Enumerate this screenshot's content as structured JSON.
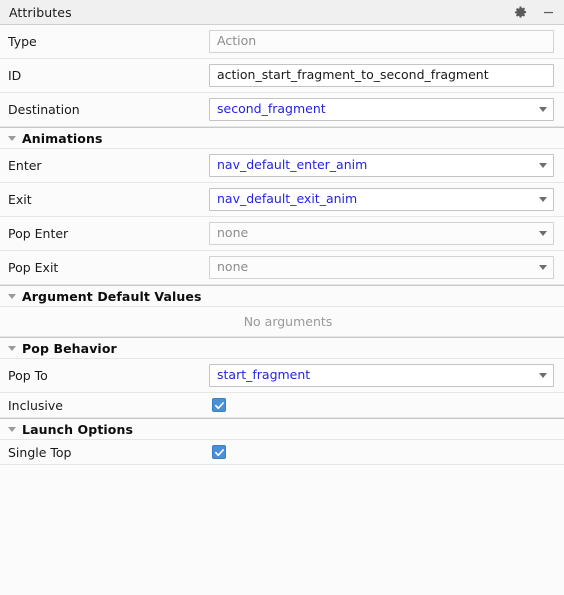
{
  "titlebar": {
    "title": "Attributes",
    "settings_icon": "gear-icon",
    "minimize_icon": "minimize-icon"
  },
  "fields": {
    "type": {
      "label": "Type",
      "value": "Action",
      "state": "muted",
      "control": "textfield"
    },
    "id": {
      "label": "ID",
      "value": "action_start_fragment_to_second_fragment",
      "state": "dark",
      "control": "textfield"
    },
    "destination": {
      "label": "Destination",
      "value": "second_fragment",
      "state": "blue",
      "control": "combobox"
    }
  },
  "sections": {
    "animations": {
      "title": "Animations",
      "rows": [
        {
          "label": "Enter",
          "value": "nav_default_enter_anim",
          "state": "blue",
          "control": "combobox"
        },
        {
          "label": "Exit",
          "value": "nav_default_exit_anim",
          "state": "blue",
          "control": "combobox"
        },
        {
          "label": "Pop Enter",
          "value": "none",
          "state": "muted",
          "control": "combobox"
        },
        {
          "label": "Pop Exit",
          "value": "none",
          "state": "muted",
          "control": "combobox"
        }
      ]
    },
    "argument_default_values": {
      "title": "Argument Default Values",
      "empty_message": "No arguments"
    },
    "pop_behavior": {
      "title": "Pop Behavior",
      "pop_to": {
        "label": "Pop To",
        "value": "start_fragment",
        "state": "blue",
        "control": "combobox"
      },
      "inclusive": {
        "label": "Inclusive",
        "checked": true
      }
    },
    "launch_options": {
      "title": "Launch Options",
      "single_top": {
        "label": "Single Top",
        "checked": true
      }
    }
  },
  "colors": {
    "accent_blue": "#2424e0",
    "checkbox_blue": "#4a90d9",
    "muted_text": "#8d8d8d",
    "titlebar_bg": "#f0f0f0",
    "panel_bg": "#fbfbfb"
  }
}
